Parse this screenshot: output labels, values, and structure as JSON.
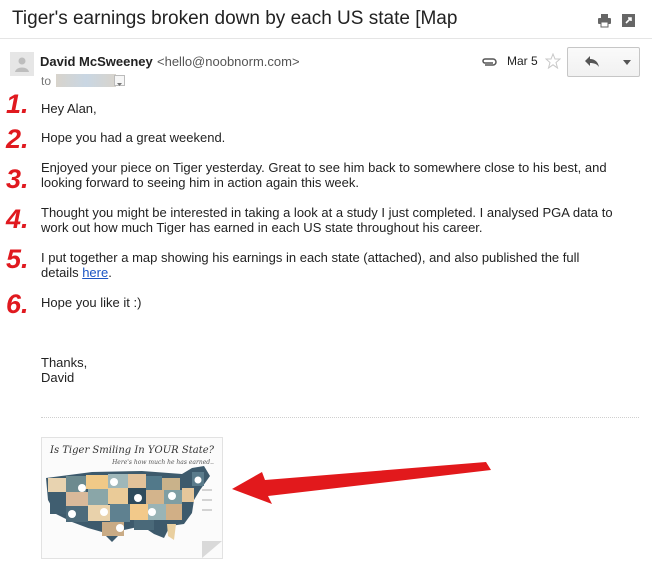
{
  "subject": "Tiger's earnings broken down by each US state [Map",
  "sender": {
    "name": "David McSweeney",
    "email": "<hello@noobnorm.com>"
  },
  "date": "Mar 5",
  "to_label": "to",
  "numbers": [
    "1.",
    "2.",
    "3.",
    "4.",
    "5.",
    "6."
  ],
  "body": {
    "p1": "Hey Alan,",
    "p2": "Hope you had a great weekend.",
    "p3_line1": "Enjoyed your piece on Tiger yesterday. Great to see him back to somewhere close to his best, and",
    "p3_line2": "looking forward to seeing him in action again this week.",
    "p4_line1": "Thought you might be interested in taking a look at a study I just completed. I analysed PGA data to",
    "p4_line2": "work out how much Tiger has earned in each US state throughout his career.",
    "p5_line1": "I put together a map showing his earnings in each state (attached), and also published the full",
    "p5_line2_pre": "details ",
    "p5_link": "here",
    "p5_line2_post": ".",
    "p6": "Hope you like it :)",
    "signoff": "Thanks,",
    "signature": "David"
  },
  "attachment": {
    "title": "Is Tiger Smiling In YOUR State?",
    "subtitle": "Here's how much he has earned.."
  },
  "colors": {
    "accent_red": "#e0191f",
    "link": "#1a55c4"
  },
  "icons": [
    "print-icon",
    "popout-icon",
    "paperclip-icon",
    "star-icon",
    "reply-icon",
    "chevron-down-icon",
    "arrow-annotation"
  ]
}
